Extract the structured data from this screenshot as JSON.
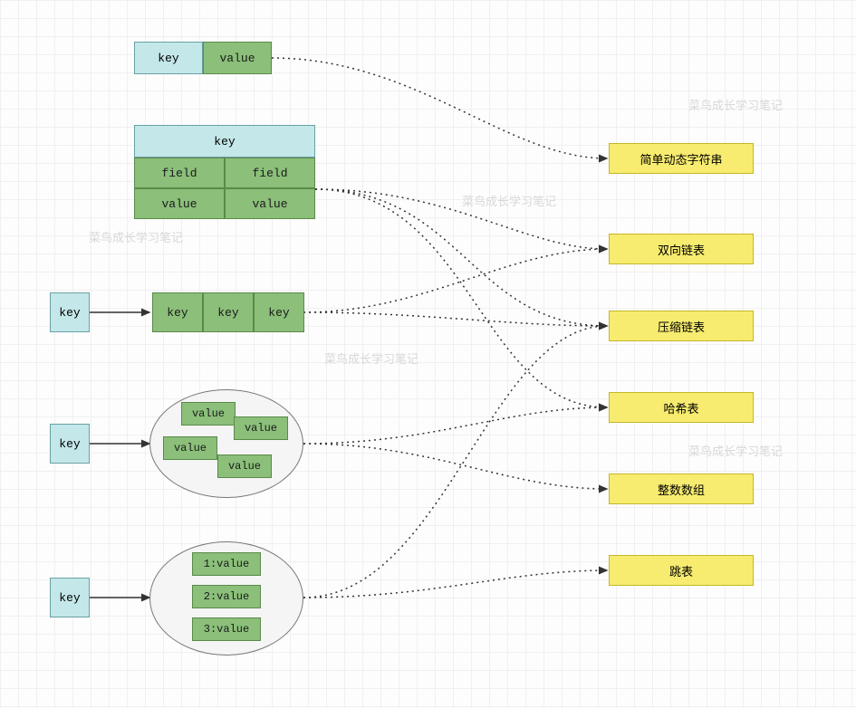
{
  "labels": {
    "key": "key",
    "value": "value",
    "field": "field",
    "v1": "1:value",
    "v2": "2:value",
    "v3": "3:value"
  },
  "targets": {
    "sds": "简单动态字符串",
    "dlist": "双向链表",
    "ziplist": "压缩链表",
    "hashtable": "哈希表",
    "intset": "整数数组",
    "skiplist": "跳表"
  },
  "watermark": "菜鸟成长学习笔记"
}
